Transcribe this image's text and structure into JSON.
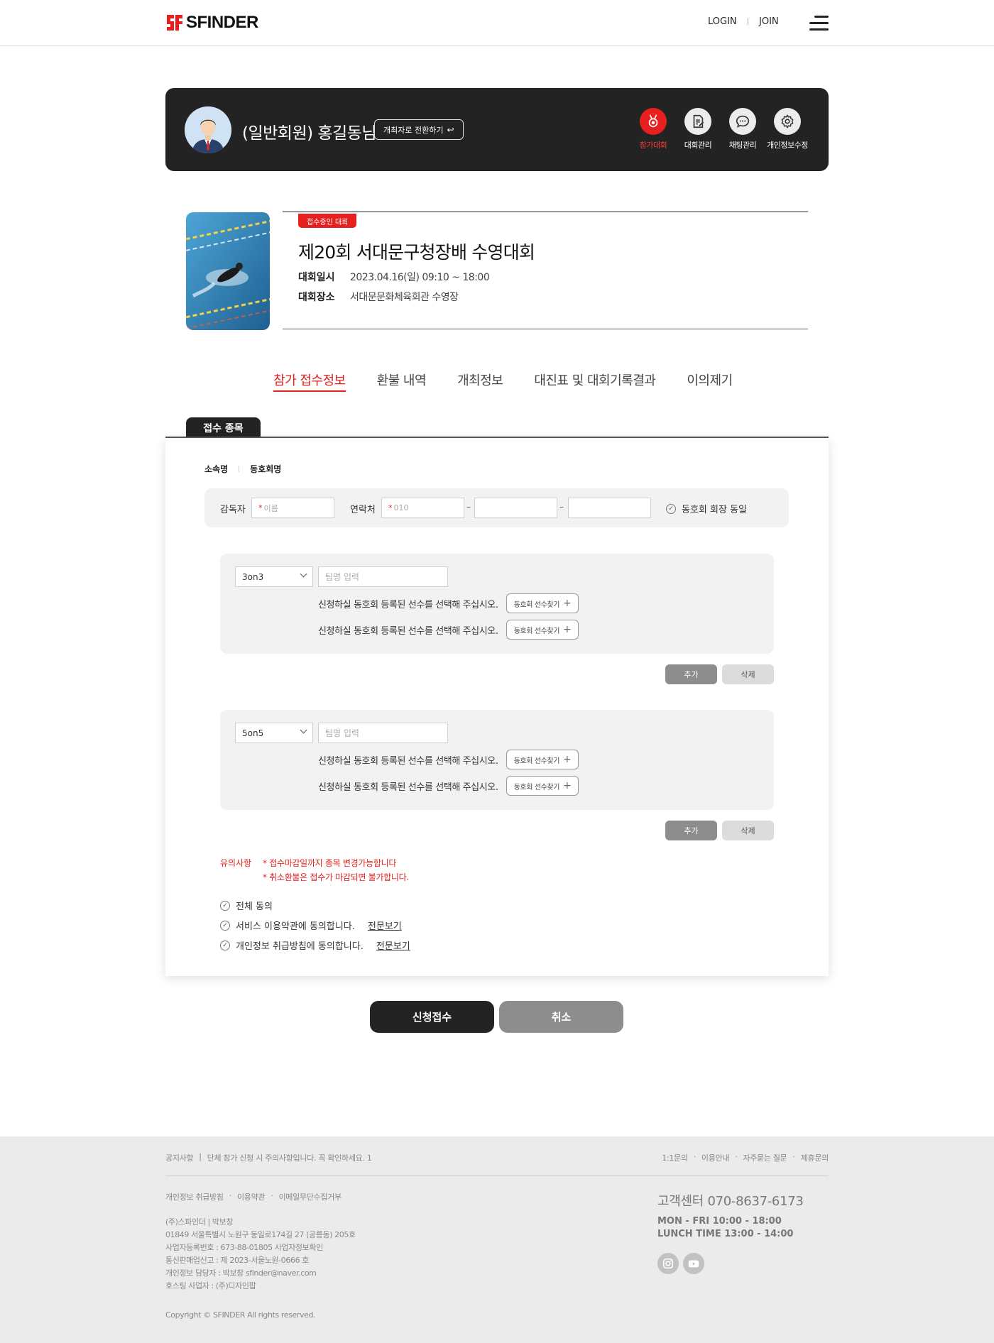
{
  "header": {
    "logo_text": "SFINDER",
    "login_label": "LOGIN",
    "join_label": "JOIN"
  },
  "member": {
    "name": "(일반회원) 홍길동님",
    "switch_label": "개최자로 전환하기",
    "nav": [
      {
        "label": "참가대회",
        "icon": "medal-icon",
        "active": true
      },
      {
        "label": "대회관리",
        "icon": "document-icon",
        "active": false
      },
      {
        "label": "채팅관리",
        "icon": "chat-icon",
        "active": false
      },
      {
        "label": "개인정보수정",
        "icon": "gear-icon",
        "active": false
      }
    ]
  },
  "event": {
    "status": "접수중인 대회",
    "title": "제20회 서대문구청장배 수영대회",
    "date_label": "대회일시",
    "date_value": "2023.04.16(일) 09:10 ~ 18:00",
    "place_label": "대회장소",
    "place_value": "서대문문화체육회관 수영장"
  },
  "tabs": [
    {
      "label": "참가 접수정보",
      "active": true
    },
    {
      "label": "환불 내역",
      "active": false
    },
    {
      "label": "개최정보",
      "active": false
    },
    {
      "label": "대진표 및 대회기록결과",
      "active": false
    },
    {
      "label": "이의제기",
      "active": false
    }
  ],
  "form": {
    "card_tab": "접수 종목",
    "affiliation_label": "소속명",
    "affiliation_value": "동호회명",
    "coach_label": "감독자",
    "coach_placeholder": "이름",
    "contact_label": "연락처",
    "contact_placeholder": "010",
    "same_as_president": "동호회 회장 동일",
    "teams": [
      {
        "type": "3on3",
        "team_placeholder": "팀명 입력",
        "rows": [
          {
            "text": "신청하실 동호회 등록된 선수를 선택해 주십시오.",
            "button": "동호회 선수찾기"
          },
          {
            "text": "신청하실 동호회 등록된 선수를 선택해 주십시오.",
            "button": "동호회 선수찾기"
          }
        ]
      },
      {
        "type": "5on5",
        "team_placeholder": "팀명 입력",
        "rows": [
          {
            "text": "신청하실 동호회 등록된 선수를 선택해 주십시오.",
            "button": "동호회 선수찾기"
          },
          {
            "text": "신청하실 동호회 등록된 선수를 선택해 주십시오.",
            "button": "동호회 선수찾기"
          }
        ]
      }
    ],
    "add_label": "추가",
    "delete_label": "삭제",
    "notice_label": "유의사항",
    "notices": [
      "* 접수마감일까지 종목 변경가능합니다",
      "* 취소환불은 접수가 마감되면 불가합니다."
    ],
    "agree_all": "전체 동의",
    "agree_terms": "서비스 이용약관에 동의합니다.",
    "agree_privacy": "개인정보 취급방침에 동의합니다.",
    "view_full": "전문보기"
  },
  "actions": {
    "submit": "신청접수",
    "cancel": "취소"
  },
  "footer": {
    "notice_label": "공지사항",
    "notice_text": "단체 참가 신청 시 주의사항입니다. 꼭 확인하세요. 1",
    "right_links": [
      "1:1문의",
      "이용안내",
      "자주묻는 질문",
      "제휴문의"
    ],
    "links": [
      "개인정보 취급방침",
      "이용약관",
      "이메일무단수집거부"
    ],
    "company_lines": [
      "(주)스파인더  |  박보창",
      "01849 서울특별시 노원구 동일로174길 27 (공릉동) 205호",
      "사업자등록번호 : 673-88-01805 사업자정보확인",
      "통신판매업신고 : 제 2023-서울노원-0666 호",
      "개인정보 담당자 : 박보창 sfinder@naver.com",
      "호스팅 사업자 : (주)디자인팝"
    ],
    "copyright": "Copyright © SFINDER All rights reserved.",
    "cs_title": "고객센터 070-8637-6173",
    "cs_hours_1": "MON - FRI  10:00 - 18:00",
    "cs_hours_2": "LUNCH TIME  13:00 - 14:00",
    "sns": [
      "instagram-icon",
      "youtube-icon"
    ]
  },
  "colors": {
    "accent": "#e5201f",
    "dark": "#232323",
    "gray_button": "#8d8d8d"
  }
}
